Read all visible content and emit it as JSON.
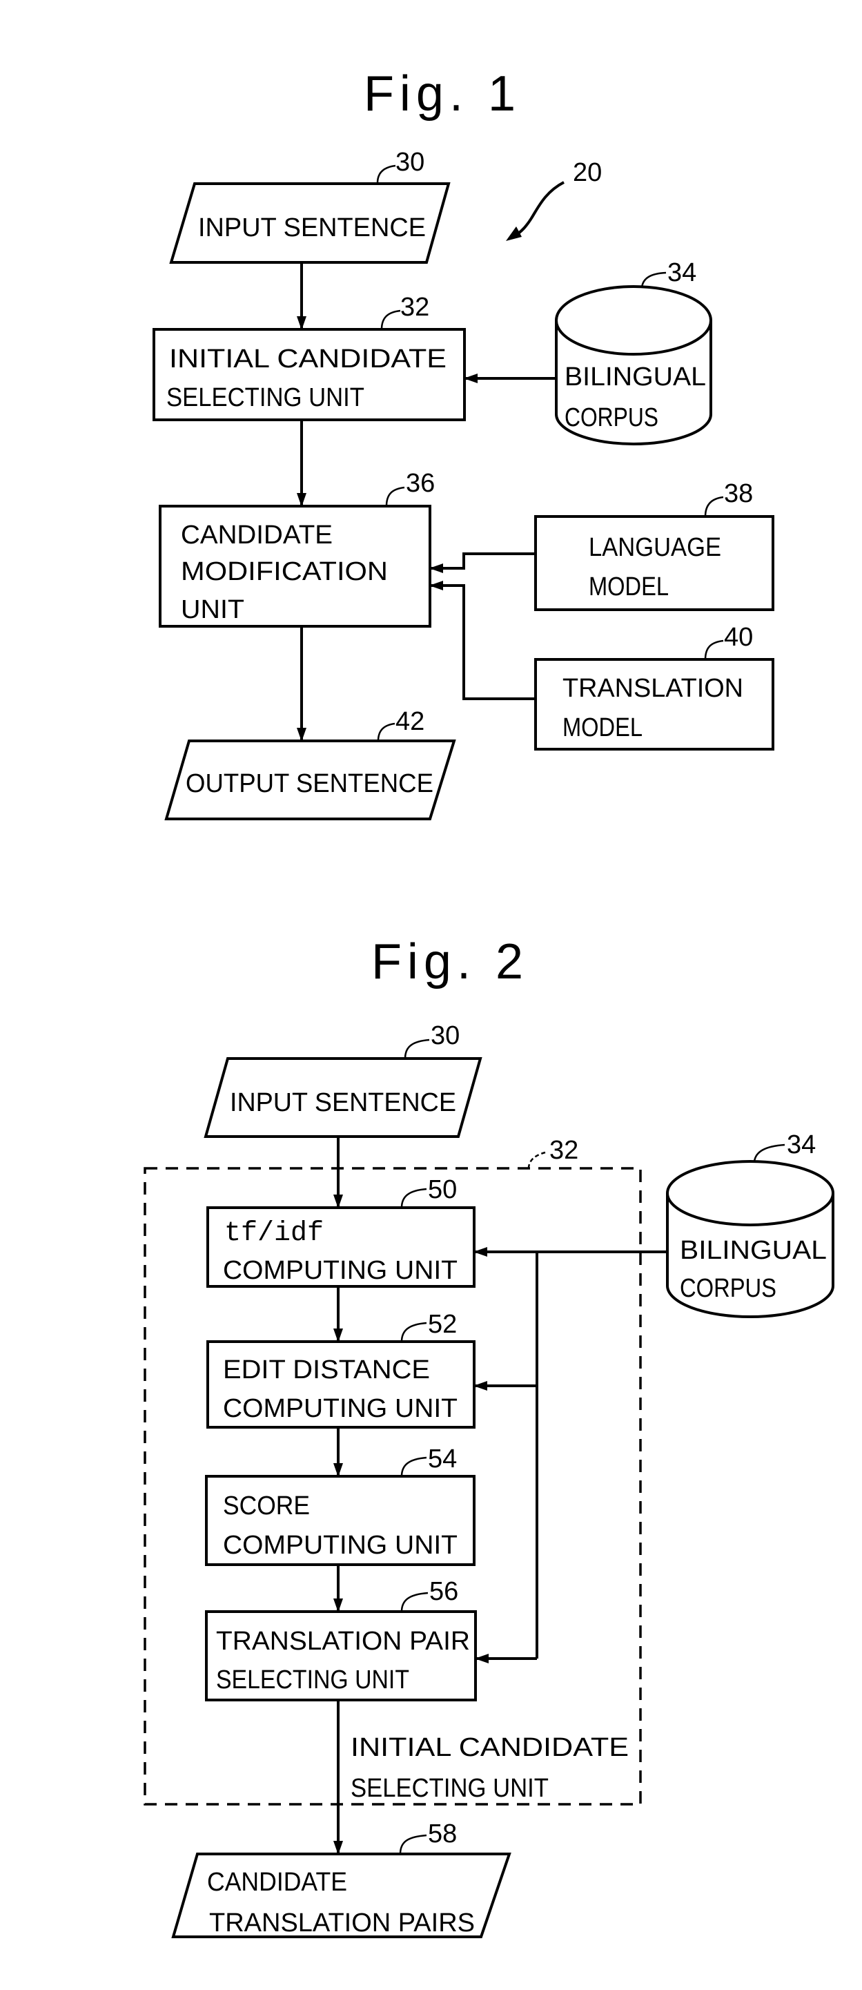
{
  "figure1": {
    "title": "Fig. 1",
    "system_ref": "20",
    "input": {
      "ref": "30",
      "label": "INPUT SENTENCE"
    },
    "initial_candidate_unit": {
      "ref": "32",
      "lines": [
        "INITIAL CANDIDATE",
        "SELECTING UNIT"
      ]
    },
    "bilingual_corpus": {
      "ref": "34",
      "lines": [
        "BILINGUAL",
        "CORPUS"
      ]
    },
    "candidate_modification_unit": {
      "ref": "36",
      "lines": [
        "CANDIDATE",
        "MODIFICATION",
        "UNIT"
      ]
    },
    "language_model": {
      "ref": "38",
      "lines": [
        "LANGUAGE",
        "MODEL"
      ]
    },
    "translation_model": {
      "ref": "40",
      "lines": [
        "TRANSLATION",
        "MODEL"
      ]
    },
    "output": {
      "ref": "42",
      "label": "OUTPUT SENTENCE"
    }
  },
  "figure2": {
    "title": "Fig. 2",
    "input": {
      "ref": "30",
      "label": "INPUT SENTENCE"
    },
    "group": {
      "ref": "32",
      "lines": [
        "INITIAL CANDIDATE",
        "SELECTING UNIT"
      ]
    },
    "bilingual_corpus": {
      "ref": "34",
      "lines": [
        "BILINGUAL",
        "CORPUS"
      ]
    },
    "tfidf_unit": {
      "ref": "50",
      "lines": [
        "tf/idf",
        "COMPUTING UNIT"
      ]
    },
    "edit_distance_unit": {
      "ref": "52",
      "lines": [
        "EDIT DISTANCE",
        "COMPUTING UNIT"
      ]
    },
    "score_unit": {
      "ref": "54",
      "lines": [
        "SCORE",
        "COMPUTING UNIT"
      ]
    },
    "pair_selecting_unit": {
      "ref": "56",
      "lines": [
        "TRANSLATION PAIR",
        "SELECTING UNIT"
      ]
    },
    "output": {
      "ref": "58",
      "lines": [
        "CANDIDATE",
        "TRANSLATION PAIRS"
      ]
    }
  }
}
